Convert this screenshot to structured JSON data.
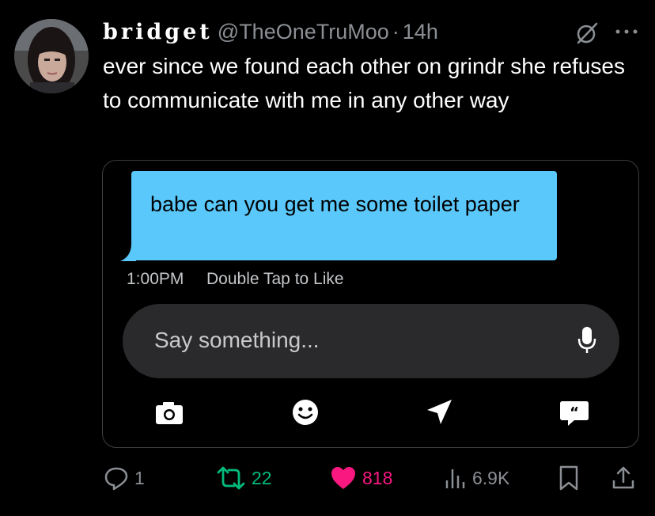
{
  "tweet": {
    "display_name": "bridget",
    "handle": "@TheOneTruMoo",
    "separator": "·",
    "time": "14h",
    "text": "ever since we found each other on grindr she refuses to communicate with me in any other way"
  },
  "media": {
    "message": "babe can you get me some toilet paper",
    "message_time": "1:00PM",
    "hint": "Double Tap to Like",
    "compose_placeholder": "Say something...",
    "bubble_color": "#5ac8fa",
    "compose_bg": "#2a2a2c",
    "toolbar_icons": [
      "camera-icon",
      "smiley-icon",
      "location-arrow-icon",
      "quote-bubble-icon"
    ]
  },
  "actions": {
    "replies": "1",
    "reposts": "22",
    "likes": "818",
    "views": "6.9K"
  },
  "colors": {
    "background": "#000000",
    "text": "#ffffff",
    "muted": "#8b8f94",
    "repost": "#00ba7c",
    "like": "#f91880"
  }
}
